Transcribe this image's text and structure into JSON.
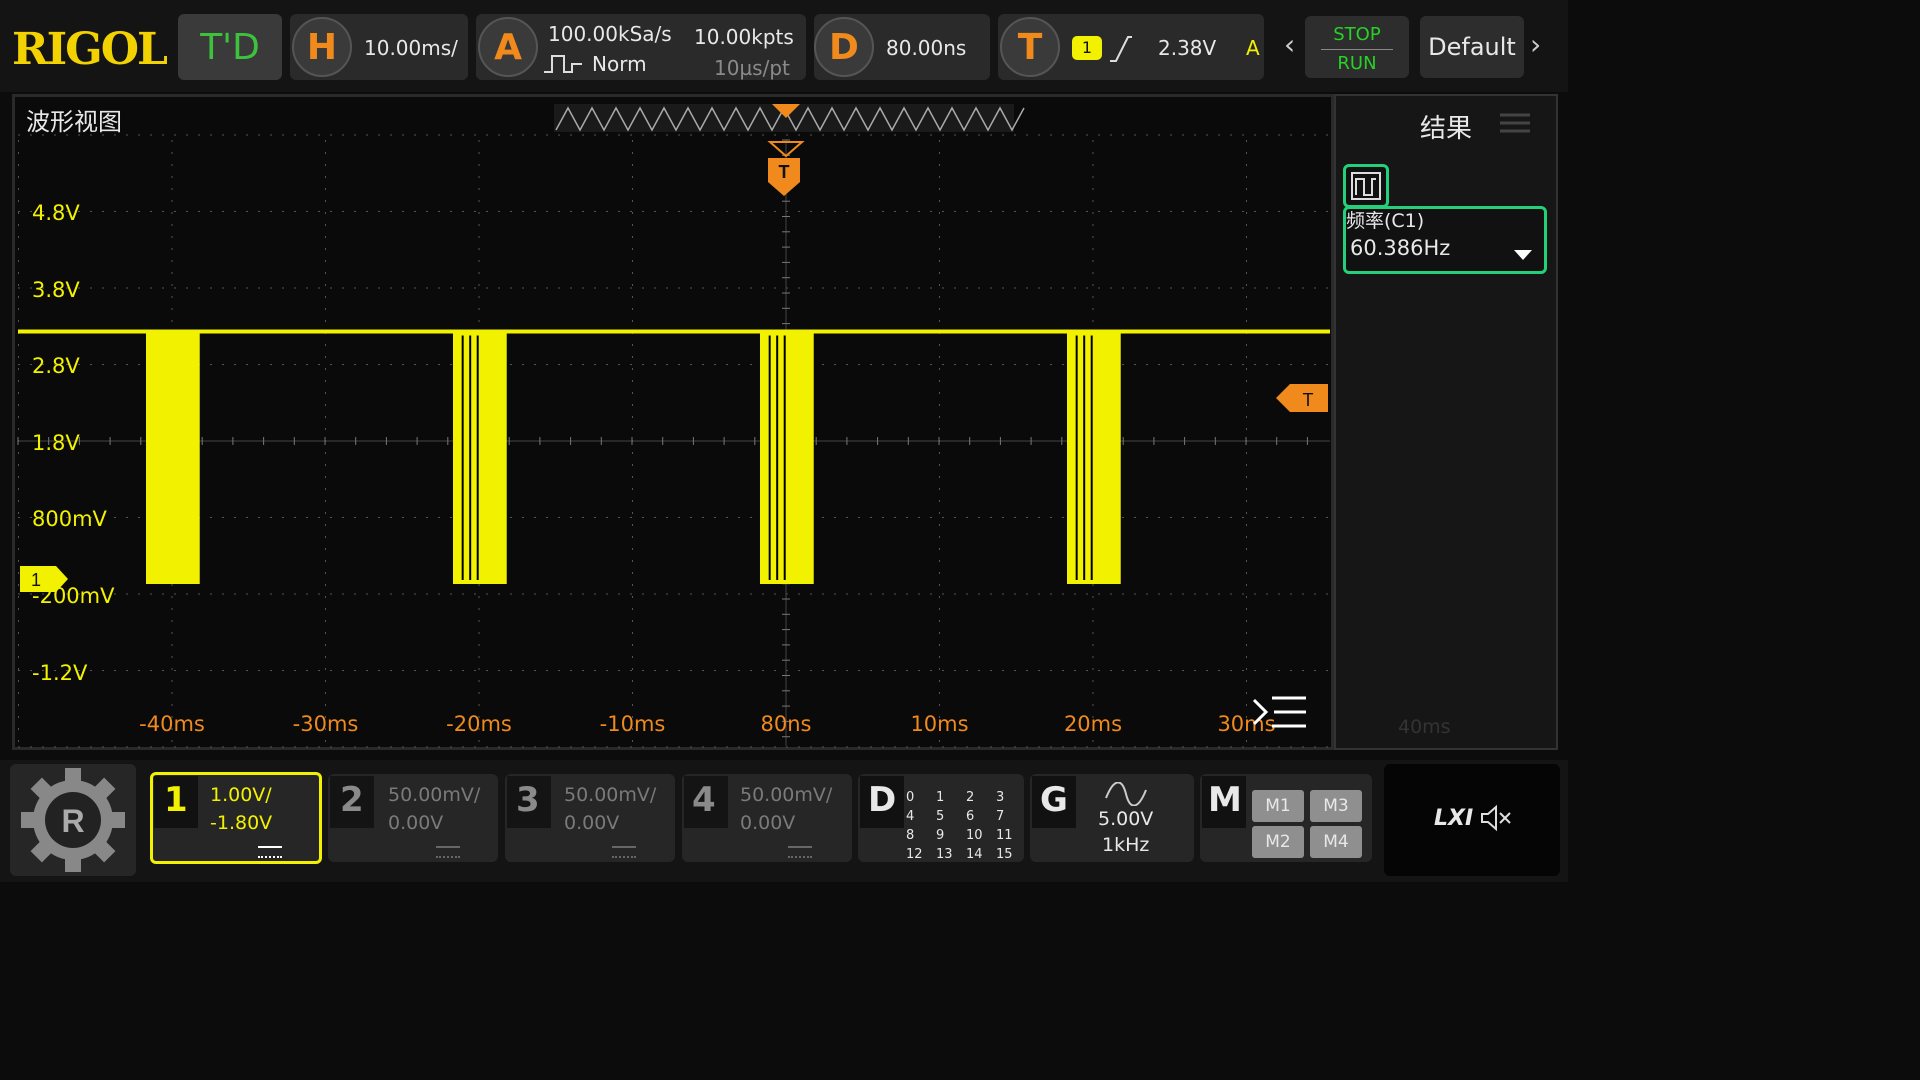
{
  "brand": "RIGOL",
  "mode_button": "T'D",
  "horizontal": {
    "icon": "H",
    "scale": "10.00ms/"
  },
  "acquire": {
    "icon": "A",
    "sample_rate": "100.00kSa/s",
    "memory_depth": "10.00kpts",
    "mode": "Norm",
    "time_per_point": "10µs/pt"
  },
  "delay": {
    "icon": "D",
    "value": "80.00ns"
  },
  "trigger": {
    "icon": "T",
    "channel": "1",
    "level": "2.38V",
    "sweep": "A"
  },
  "run_control": {
    "stop_label": "STOP",
    "run_label": "RUN"
  },
  "default_label": "Default",
  "waveform_view_title": "波形视图",
  "results_title": "结果",
  "measurement": {
    "name": "频率(C1)",
    "value": "60.386Hz"
  },
  "y_axis_labels": [
    "4.8V",
    "3.8V",
    "2.8V",
    "1.8V",
    "800mV",
    "-200mV",
    "-1.2V"
  ],
  "x_axis_labels": [
    "-40ms",
    "-30ms",
    "-20ms",
    "-10ms",
    "80ns",
    "10ms",
    "20ms",
    "30ms"
  ],
  "results_panel_xlabel": "40ms",
  "channel_marker": "1",
  "trigger_marker": "T",
  "channels": [
    {
      "num": "1",
      "scale": "1.00V/",
      "offset": "-1.80V",
      "active": true,
      "color": "#f2f200"
    },
    {
      "num": "2",
      "scale": "50.00mV/",
      "offset": "0.00V",
      "active": false
    },
    {
      "num": "3",
      "scale": "50.00mV/",
      "offset": "0.00V",
      "active": false
    },
    {
      "num": "4",
      "scale": "50.00mV/",
      "offset": "0.00V",
      "active": false
    }
  ],
  "digital": {
    "label": "D",
    "channels": [
      "0",
      "1",
      "2",
      "3",
      "4",
      "5",
      "6",
      "7",
      "8",
      "9",
      "10",
      "11",
      "12",
      "13",
      "14",
      "15"
    ]
  },
  "generator": {
    "label": "G",
    "amplitude": "5.00V",
    "frequency": "1kHz"
  },
  "math": {
    "label": "M",
    "buttons": [
      "M1",
      "M3",
      "M2",
      "M4"
    ]
  },
  "lxi_label": "LXI",
  "colors": {
    "ch1": "#f2f200",
    "trigger": "#f08a1c",
    "accent": "#25d07a",
    "run": "#28d028"
  },
  "signal": {
    "high_level_V": 3.3,
    "low_level_V": 0.0,
    "burst_centers_ms": [
      -40,
      -20,
      0,
      20
    ],
    "burst_width_ms": 3.5
  }
}
